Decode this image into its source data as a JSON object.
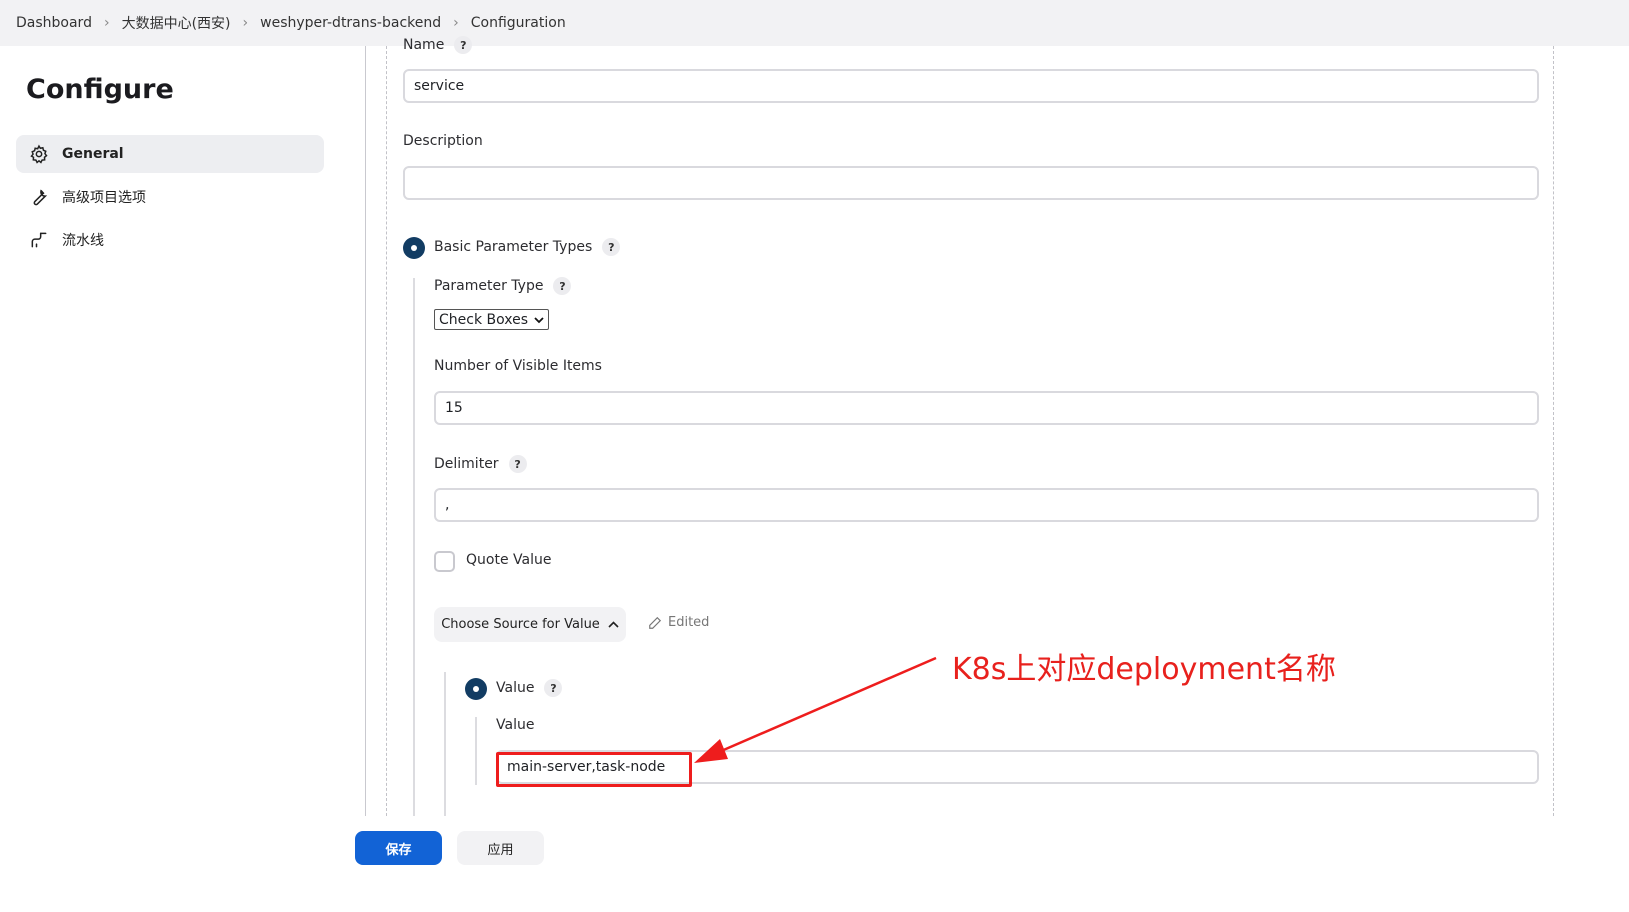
{
  "breadcrumb": [
    "Dashboard",
    "大数据中心(西安)",
    "weshyper-dtrans-backend",
    "Configuration"
  ],
  "page_title": "Configure",
  "sidebar": {
    "items": [
      {
        "label": "General",
        "icon": "gear-icon",
        "active": true
      },
      {
        "label": "高级项目选项",
        "icon": "wrench-icon",
        "active": false
      },
      {
        "label": "流水线",
        "icon": "pipeline-icon",
        "active": false
      }
    ]
  },
  "form": {
    "name_label": "Name",
    "name_value": "service",
    "description_label": "Description",
    "description_value": "",
    "basic_param_types_label": "Basic Parameter Types",
    "parameter_type_label": "Parameter Type",
    "parameter_type_value": "Check Boxes",
    "visible_items_label": "Number of Visible Items",
    "visible_items_value": "15",
    "delimiter_label": "Delimiter",
    "delimiter_value": ",",
    "quote_value_label": "Quote Value",
    "choose_source_label": "Choose Source for Value",
    "edited_label": "Edited",
    "value_radio_label": "Value",
    "value_field_label": "Value",
    "value_field_value": "main-server,task-node"
  },
  "annotation": {
    "text": "K8s上对应deployment名称",
    "color": "#e8211d"
  },
  "actions": {
    "save_label": "保存",
    "apply_label": "应用"
  },
  "colors": {
    "primary": "#1263d6",
    "radio": "#123c63"
  }
}
